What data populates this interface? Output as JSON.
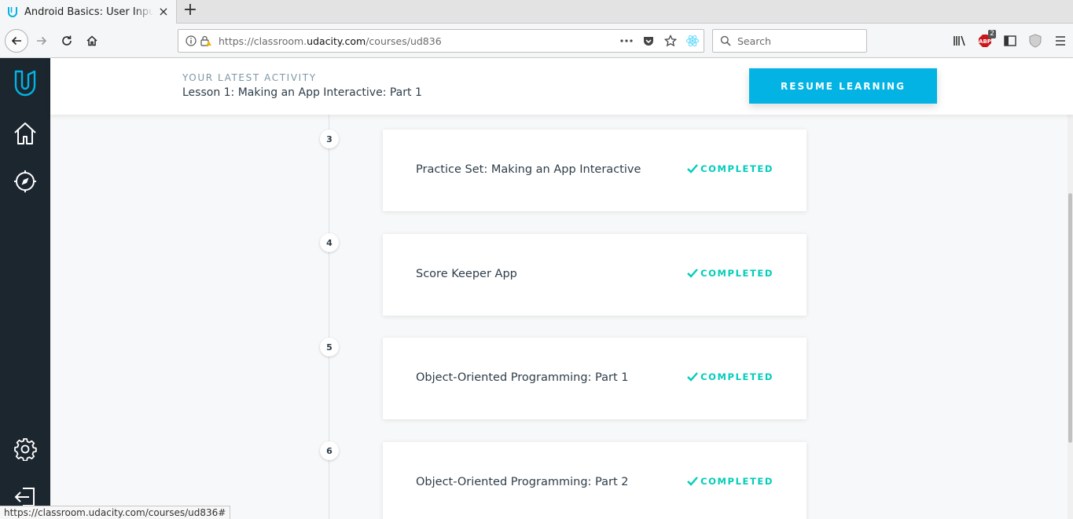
{
  "browser": {
    "tab_title": "Android Basics: User Input - Udacity",
    "url_prefix": "https://classroom.",
    "url_host": "udacity.com",
    "url_path": "/courses/ud836",
    "search_placeholder": "Search",
    "addon_badge": "2",
    "status_url": "https://classroom.udacity.com/courses/ud836#"
  },
  "header": {
    "eyebrow": "YOUR LATEST ACTIVITY",
    "lesson": "Lesson 1: Making an App Interactive: Part 1",
    "resume_label": "RESUME LEARNING"
  },
  "lessons": [
    {
      "number": "3",
      "title": "Practice Set: Making an App Interactive",
      "status": "COMPLETED"
    },
    {
      "number": "4",
      "title": "Score Keeper App",
      "status": "COMPLETED"
    },
    {
      "number": "5",
      "title": "Object-Oriented Programming: Part 1",
      "status": "COMPLETED"
    },
    {
      "number": "6",
      "title": "Object-Oriented Programming: Part 2",
      "status": "COMPLETED"
    }
  ],
  "colors": {
    "accent": "#02b3e4",
    "completed": "#02ccba",
    "sidebar": "#1c262f"
  },
  "icons": [
    "udacity-logo",
    "home-icon",
    "compass-icon",
    "gear-icon",
    "logout-icon"
  ]
}
